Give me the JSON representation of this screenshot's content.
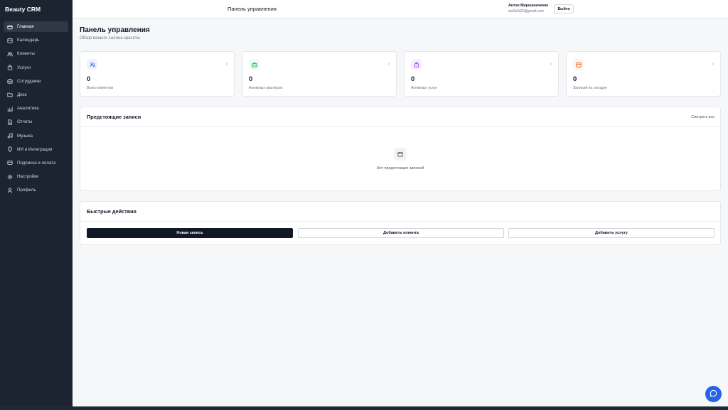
{
  "app": {
    "brand": "Beauty CRM"
  },
  "sidebar": {
    "items": [
      {
        "label": "Главная",
        "icon": "home-icon",
        "active": true
      },
      {
        "label": "Календарь",
        "icon": "calendar-icon"
      },
      {
        "label": "Клиенты",
        "icon": "users-icon"
      },
      {
        "label": "Услуги",
        "icon": "bag-icon"
      },
      {
        "label": "Сотрудники",
        "icon": "briefcase-icon"
      },
      {
        "label": "Диск",
        "icon": "folder-icon"
      },
      {
        "label": "Аналитика",
        "icon": "chart-icon"
      },
      {
        "label": "Отчеты",
        "icon": "document-icon"
      },
      {
        "label": "Музыка",
        "icon": "music-icon"
      },
      {
        "label": "ИИ и Интеграции",
        "icon": "bulb-icon"
      },
      {
        "label": "Подписка и оплата",
        "icon": "card-icon"
      },
      {
        "label": "Настройки",
        "icon": "gear-icon"
      },
      {
        "label": "Профиль",
        "icon": "user-icon"
      }
    ]
  },
  "header": {
    "title": "Панель управления",
    "user_name": "Антон Мирошниченко",
    "user_email": "sta1k3r22@gmail.com",
    "logout_label": "Выйти"
  },
  "page": {
    "title": "Панель управления",
    "subtitle": "Обзор вашего салона красоты"
  },
  "stats": [
    {
      "value": "0",
      "label": "Всего клиентов",
      "icon": "users-icon",
      "color": "#2563eb",
      "bg": "#eef4ff"
    },
    {
      "value": "0",
      "label": "Активных мастеров",
      "icon": "briefcase-icon",
      "color": "#16a34a",
      "bg": "#ecfdf3"
    },
    {
      "value": "0",
      "label": "Активных услуг",
      "icon": "bag-icon",
      "color": "#9333ea",
      "bg": "#f6efff"
    },
    {
      "value": "0",
      "label": "Записей на сегодня",
      "icon": "calendar-icon",
      "color": "#ea580c",
      "bg": "#fff4ec"
    }
  ],
  "upcoming": {
    "title": "Предстоящие записи",
    "view_all": "Смотреть все",
    "empty_text": "Нет предстоящих записей"
  },
  "quick_actions": {
    "title": "Быстрые действия",
    "new_appointment": "Новая запись",
    "add_client": "Добавить клиента",
    "add_service": "Добавить услугу"
  },
  "colors": {
    "sidebar_bg": "#1c2431",
    "primary": "#121826",
    "chat_button": "#2563eb"
  }
}
